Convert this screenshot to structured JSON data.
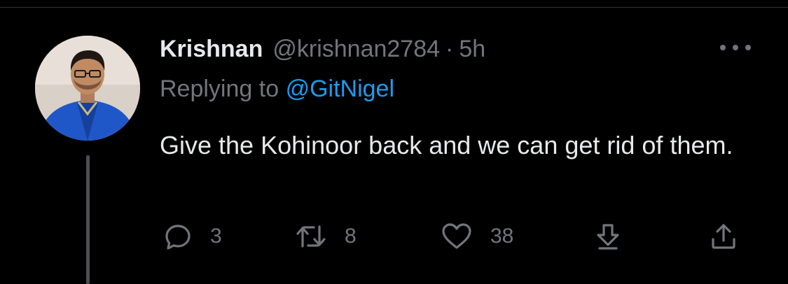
{
  "tweet": {
    "author_name": "Krishnan",
    "author_handle": "@krishnan2784",
    "separator": "·",
    "time": "5h",
    "replying_prefix": "Replying to",
    "replying_to": "@GitNigel",
    "text": "Give the Kohinoor back and we can get rid of them."
  },
  "actions": {
    "replies": "3",
    "retweets": "8",
    "likes": "38"
  },
  "icons": {
    "reply": "reply-icon",
    "retweet": "retweet-icon",
    "like": "heart-icon",
    "downvote": "down-arrow-icon",
    "share": "share-icon",
    "more": "more-icon"
  },
  "colors": {
    "background": "#000000",
    "text": "#e7e9ea",
    "muted": "#71767b",
    "link": "#1d9bf0"
  }
}
